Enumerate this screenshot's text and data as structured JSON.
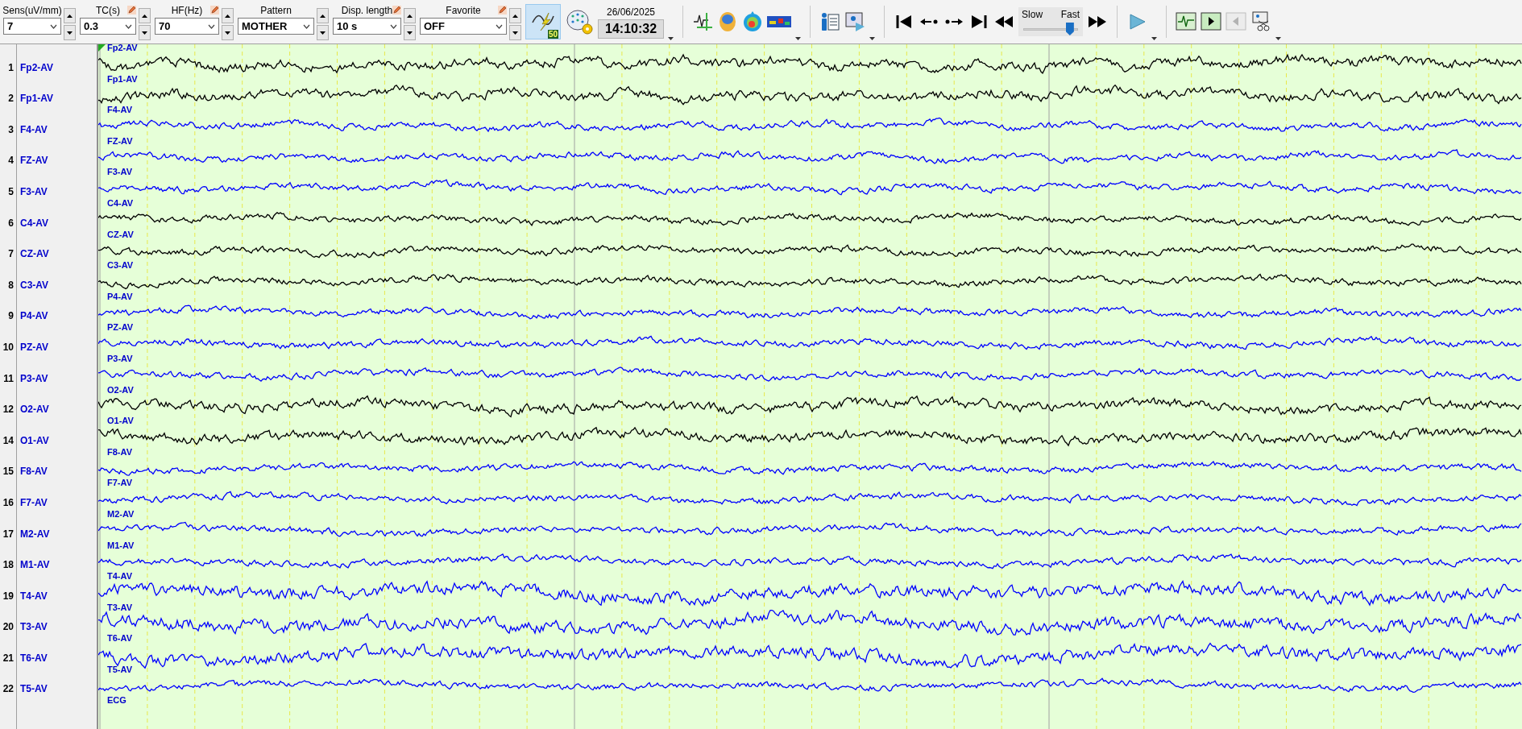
{
  "toolbar": {
    "controls": [
      {
        "label": "Sens(uV/mm)",
        "value": "7",
        "editable": false
      },
      {
        "label": "TC(s)",
        "value": "0.3",
        "editable": true
      },
      {
        "label": "HF(Hz)",
        "value": "70",
        "editable": true
      },
      {
        "label": "Pattern",
        "value": "MOTHER",
        "editable": false
      },
      {
        "label": "Disp. length",
        "value": "10 s",
        "editable": true
      },
      {
        "label": "Favorite",
        "value": "OFF",
        "editable": true
      }
    ],
    "filter_toggle": {
      "badge": "50",
      "selected": true
    },
    "date": "26/06/2025",
    "time": "14:10:32",
    "speed": {
      "slow_label": "Slow",
      "fast_label": "Fast",
      "level": 0.85
    }
  },
  "channels": [
    {
      "number": "1",
      "name": "Fp2-AV",
      "trace_label": "Fp2-AV",
      "color": "#000000"
    },
    {
      "number": "2",
      "name": "Fp1-AV",
      "trace_label": "Fp1-AV",
      "color": "#000000"
    },
    {
      "number": "3",
      "name": "F4-AV",
      "trace_label": "F4-AV",
      "color": "#0000ff"
    },
    {
      "number": "4",
      "name": "FZ-AV",
      "trace_label": "FZ-AV",
      "color": "#0000ff"
    },
    {
      "number": "5",
      "name": "F3-AV",
      "trace_label": "F3-AV",
      "color": "#0000ff"
    },
    {
      "number": "6",
      "name": "C4-AV",
      "trace_label": "C4-AV",
      "color": "#000000"
    },
    {
      "number": "7",
      "name": "CZ-AV",
      "trace_label": "CZ-AV",
      "color": "#000000"
    },
    {
      "number": "8",
      "name": "C3-AV",
      "trace_label": "C3-AV",
      "color": "#000000"
    },
    {
      "number": "9",
      "name": "P4-AV",
      "trace_label": "P4-AV",
      "color": "#0000ff"
    },
    {
      "number": "10",
      "name": "PZ-AV",
      "trace_label": "PZ-AV",
      "color": "#0000ff"
    },
    {
      "number": "11",
      "name": "P3-AV",
      "trace_label": "P3-AV",
      "color": "#0000ff"
    },
    {
      "number": "12",
      "name": "O2-AV",
      "trace_label": "O2-AV",
      "color": "#000000"
    },
    {
      "number": "14",
      "name": "O1-AV",
      "trace_label": "O1-AV",
      "color": "#000000"
    },
    {
      "number": "15",
      "name": "F8-AV",
      "trace_label": "F8-AV",
      "color": "#0000ff"
    },
    {
      "number": "16",
      "name": "F7-AV",
      "trace_label": "F7-AV",
      "color": "#0000ff"
    },
    {
      "number": "17",
      "name": "M2-AV",
      "trace_label": "M2-AV",
      "color": "#0000ff"
    },
    {
      "number": "18",
      "name": "M1-AV",
      "trace_label": "M1-AV",
      "color": "#0000ff"
    },
    {
      "number": "19",
      "name": "T4-AV",
      "trace_label": "T4-AV",
      "color": "#0000ff"
    },
    {
      "number": "20",
      "name": "T3-AV",
      "trace_label": "T3-AV",
      "color": "#0000ff"
    },
    {
      "number": "21",
      "name": "T6-AV",
      "trace_label": "T6-AV",
      "color": "#0000ff"
    },
    {
      "number": "22",
      "name": "T5-AV",
      "trace_label": "T5-AV",
      "color": "#0000ff"
    },
    {
      "trace_label": "ECG"
    }
  ]
}
